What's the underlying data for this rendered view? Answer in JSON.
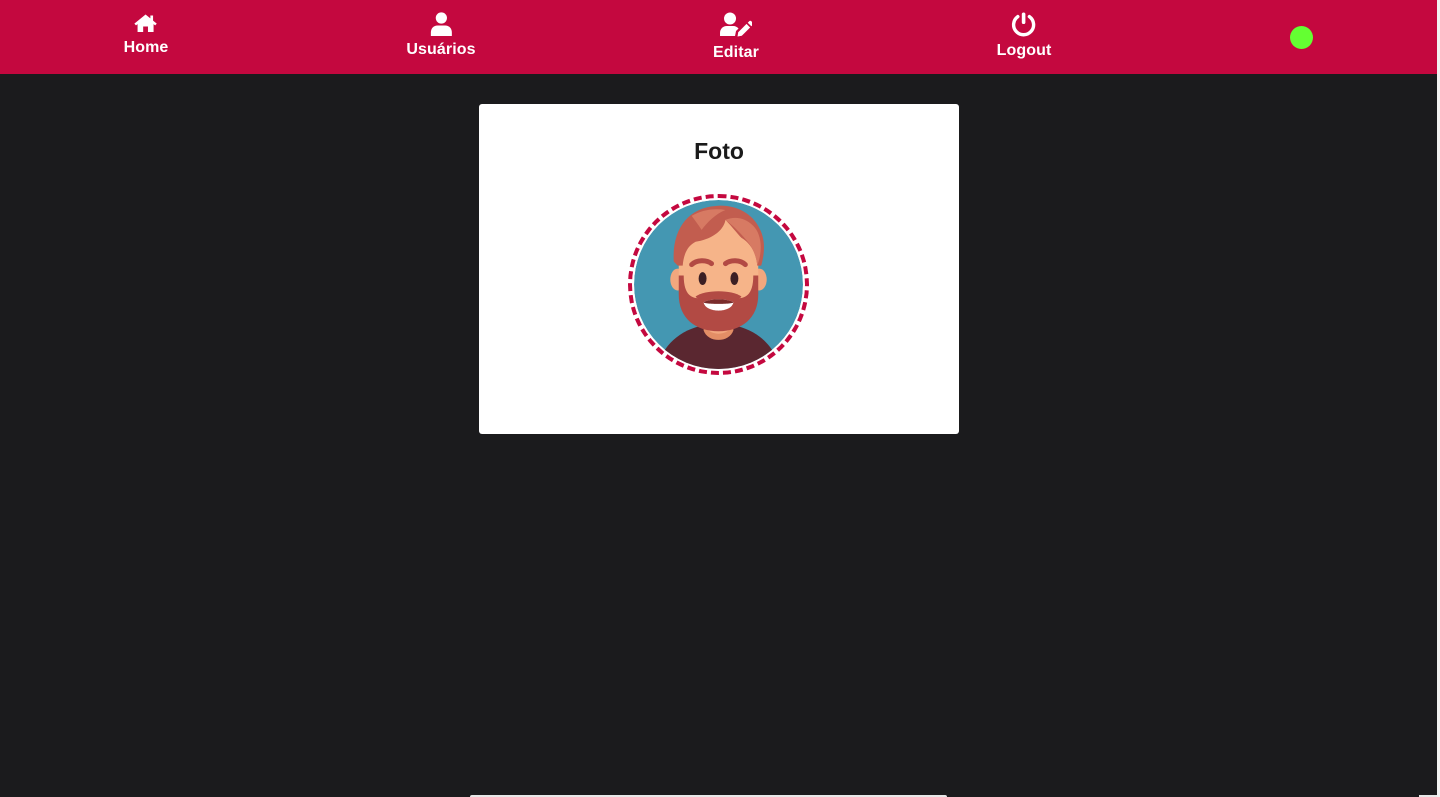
{
  "nav": {
    "items": [
      {
        "label": "Home",
        "icon": "home-icon"
      },
      {
        "label": "Usuários",
        "icon": "user-icon"
      },
      {
        "label": "Editar",
        "icon": "user-edit-icon"
      },
      {
        "label": "Logout",
        "icon": "power-icon"
      }
    ],
    "status": {
      "color": "#64ff32"
    }
  },
  "card": {
    "title": "Foto",
    "avatar": {
      "icon": "avatar-bearded-man",
      "border_color": "#c4083f"
    }
  },
  "colors": {
    "brand": "#c4083f",
    "background": "#1b1b1d",
    "card": "#ffffff"
  }
}
